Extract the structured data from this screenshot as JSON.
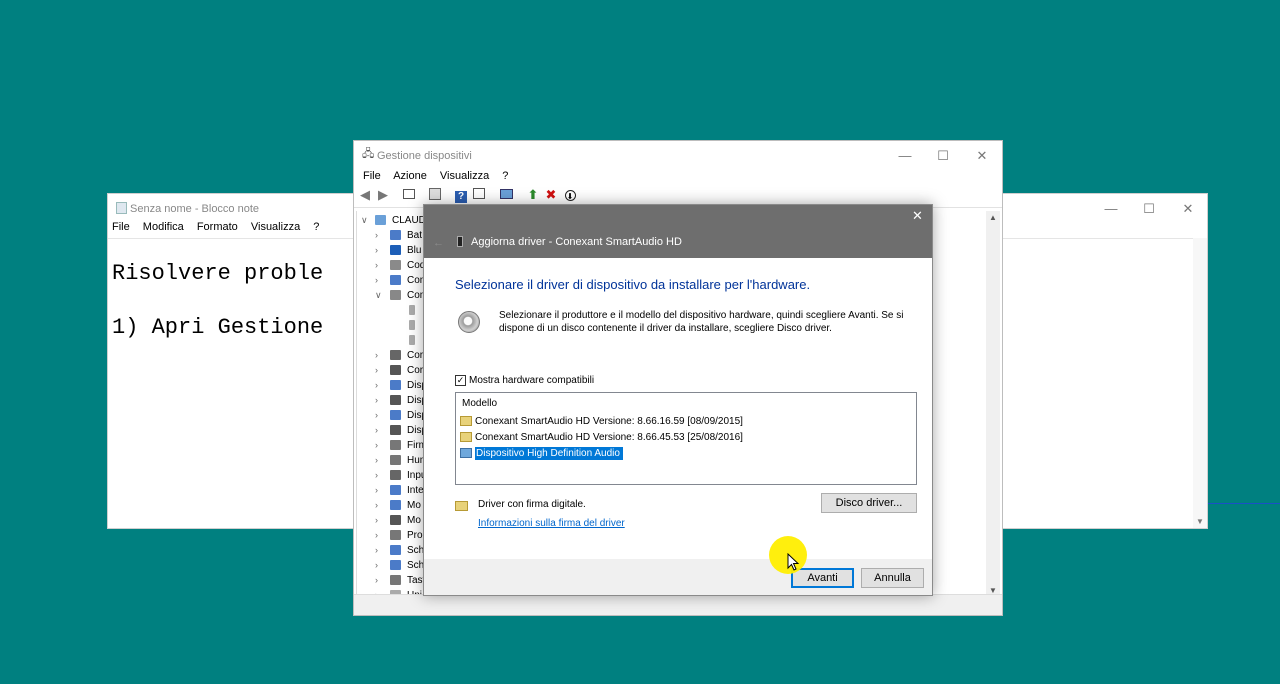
{
  "desktop": {
    "background": "#008080"
  },
  "notepad": {
    "title": "Senza nome - Blocco note",
    "menu": [
      "File",
      "Modifica",
      "Formato",
      "Visualizza",
      "?"
    ],
    "lines": [
      "Risolvere proble",
      "1) Apri Gestione"
    ]
  },
  "device_manager": {
    "title": "Gestione dispositivi",
    "menu": [
      "File",
      "Azione",
      "Visualizza",
      "?"
    ],
    "toolbar_icons": [
      "back-arrow-icon",
      "forward-arrow-icon",
      "properties-icon",
      "list-icon",
      "help-icon",
      "view-icon",
      "monitor-icon",
      "add-driver-icon",
      "uninstall-x-icon",
      "download-icon"
    ],
    "tree": {
      "root": "CLAUDI",
      "items": [
        {
          "label": "Bat",
          "expanded": false
        },
        {
          "label": "Blu",
          "expanded": false
        },
        {
          "label": "Cod",
          "expanded": false
        },
        {
          "label": "Con",
          "expanded": false
        },
        {
          "label": "Con",
          "expanded": true
        },
        {
          "label": "",
          "child": true
        },
        {
          "label": "",
          "child": true
        },
        {
          "label": "",
          "child": true
        },
        {
          "label": "Cor",
          "expanded": false
        },
        {
          "label": "Cor",
          "expanded": false
        },
        {
          "label": "Disp",
          "expanded": false
        },
        {
          "label": "Disp",
          "expanded": false
        },
        {
          "label": "Disp",
          "expanded": false
        },
        {
          "label": "Disp",
          "expanded": false
        },
        {
          "label": "Firm",
          "expanded": false
        },
        {
          "label": "Hum",
          "expanded": false
        },
        {
          "label": "Inpu",
          "expanded": false
        },
        {
          "label": "Inte",
          "expanded": false
        },
        {
          "label": "Mo",
          "expanded": false
        },
        {
          "label": "Mo",
          "expanded": false
        },
        {
          "label": "Proc",
          "expanded": false
        },
        {
          "label": "Sch",
          "expanded": false
        },
        {
          "label": "Sch",
          "expanded": false
        },
        {
          "label": "Tast",
          "expanded": false
        },
        {
          "label": "Uni",
          "expanded": false
        }
      ]
    }
  },
  "dialog": {
    "title": "Aggiorna driver - Conexant SmartAudio HD",
    "heading": "Selezionare il driver di dispositivo da installare per l'hardware.",
    "description_line1": "Selezionare il produttore e il modello del dispositivo hardware, quindi scegliere Avanti. Se si",
    "description_line2": "dispone di un disco contenente il driver da installare, scegliere Disco driver.",
    "checkbox_label": "Mostra hardware compatibili",
    "checkbox_checked": true,
    "list_header": "Modello",
    "models": [
      "Conexant SmartAudio HD Versione: 8.66.16.59 [08/09/2015]",
      "Conexant SmartAudio HD Versione: 8.66.45.53 [25/08/2016]",
      "Dispositivo High Definition Audio"
    ],
    "selected_index": 2,
    "signed_text": "Driver con firma digitale.",
    "disk_button": "Disco driver...",
    "info_link": "Informazioni sulla firma del driver",
    "next_button": "Avanti",
    "cancel_button": "Annulla",
    "accent": "#0078d7",
    "heading_color": "#003399"
  }
}
